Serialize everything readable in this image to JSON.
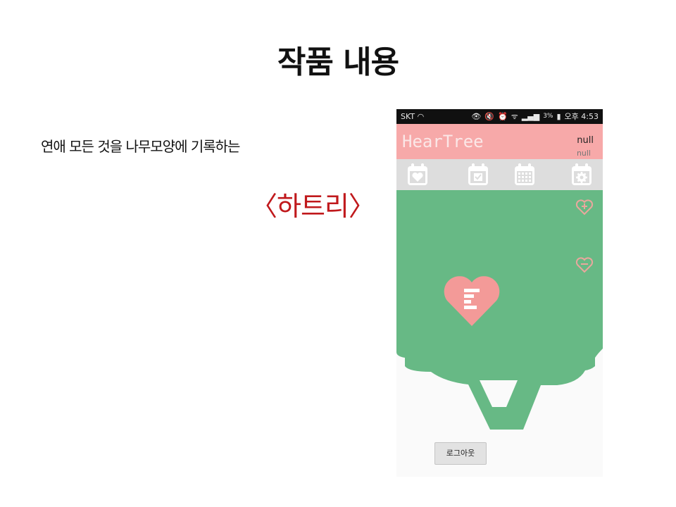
{
  "slide": {
    "title": "작품 내용",
    "description": "연애 모든 것을 나무모양에 기록하는",
    "highlight": "〈하트리〉"
  },
  "colors": {
    "accent_red": "#c0191c",
    "appbar_pink": "#f7a9a9",
    "tree_green": "#67b985",
    "heart_pink": "#f39a98",
    "icon_bar_gray": "#dddddd"
  },
  "phone": {
    "statusbar": {
      "carrier": "SKT",
      "battery": "3%",
      "time": "오후 4:53",
      "icons": [
        "headset-icon",
        "eye-icon",
        "mute-icon",
        "alarm-icon",
        "wifi-icon",
        "signal-icon",
        "battery-icon"
      ]
    },
    "appbar": {
      "title": "HearTree",
      "user_line1": "null",
      "user_line2": "null"
    },
    "tabs": [
      {
        "icon": "calendar-heart-icon"
      },
      {
        "icon": "calendar-check-icon"
      },
      {
        "icon": "calendar-grid-icon"
      },
      {
        "icon": "calendar-settings-icon"
      }
    ],
    "side_buttons": [
      {
        "icon": "heart-plus-icon"
      },
      {
        "icon": "heart-minus-icon"
      }
    ],
    "tree": {
      "icon": "tree-icon",
      "heart_icon": "heart-menu-icon"
    },
    "logout_label": "로그아웃"
  }
}
